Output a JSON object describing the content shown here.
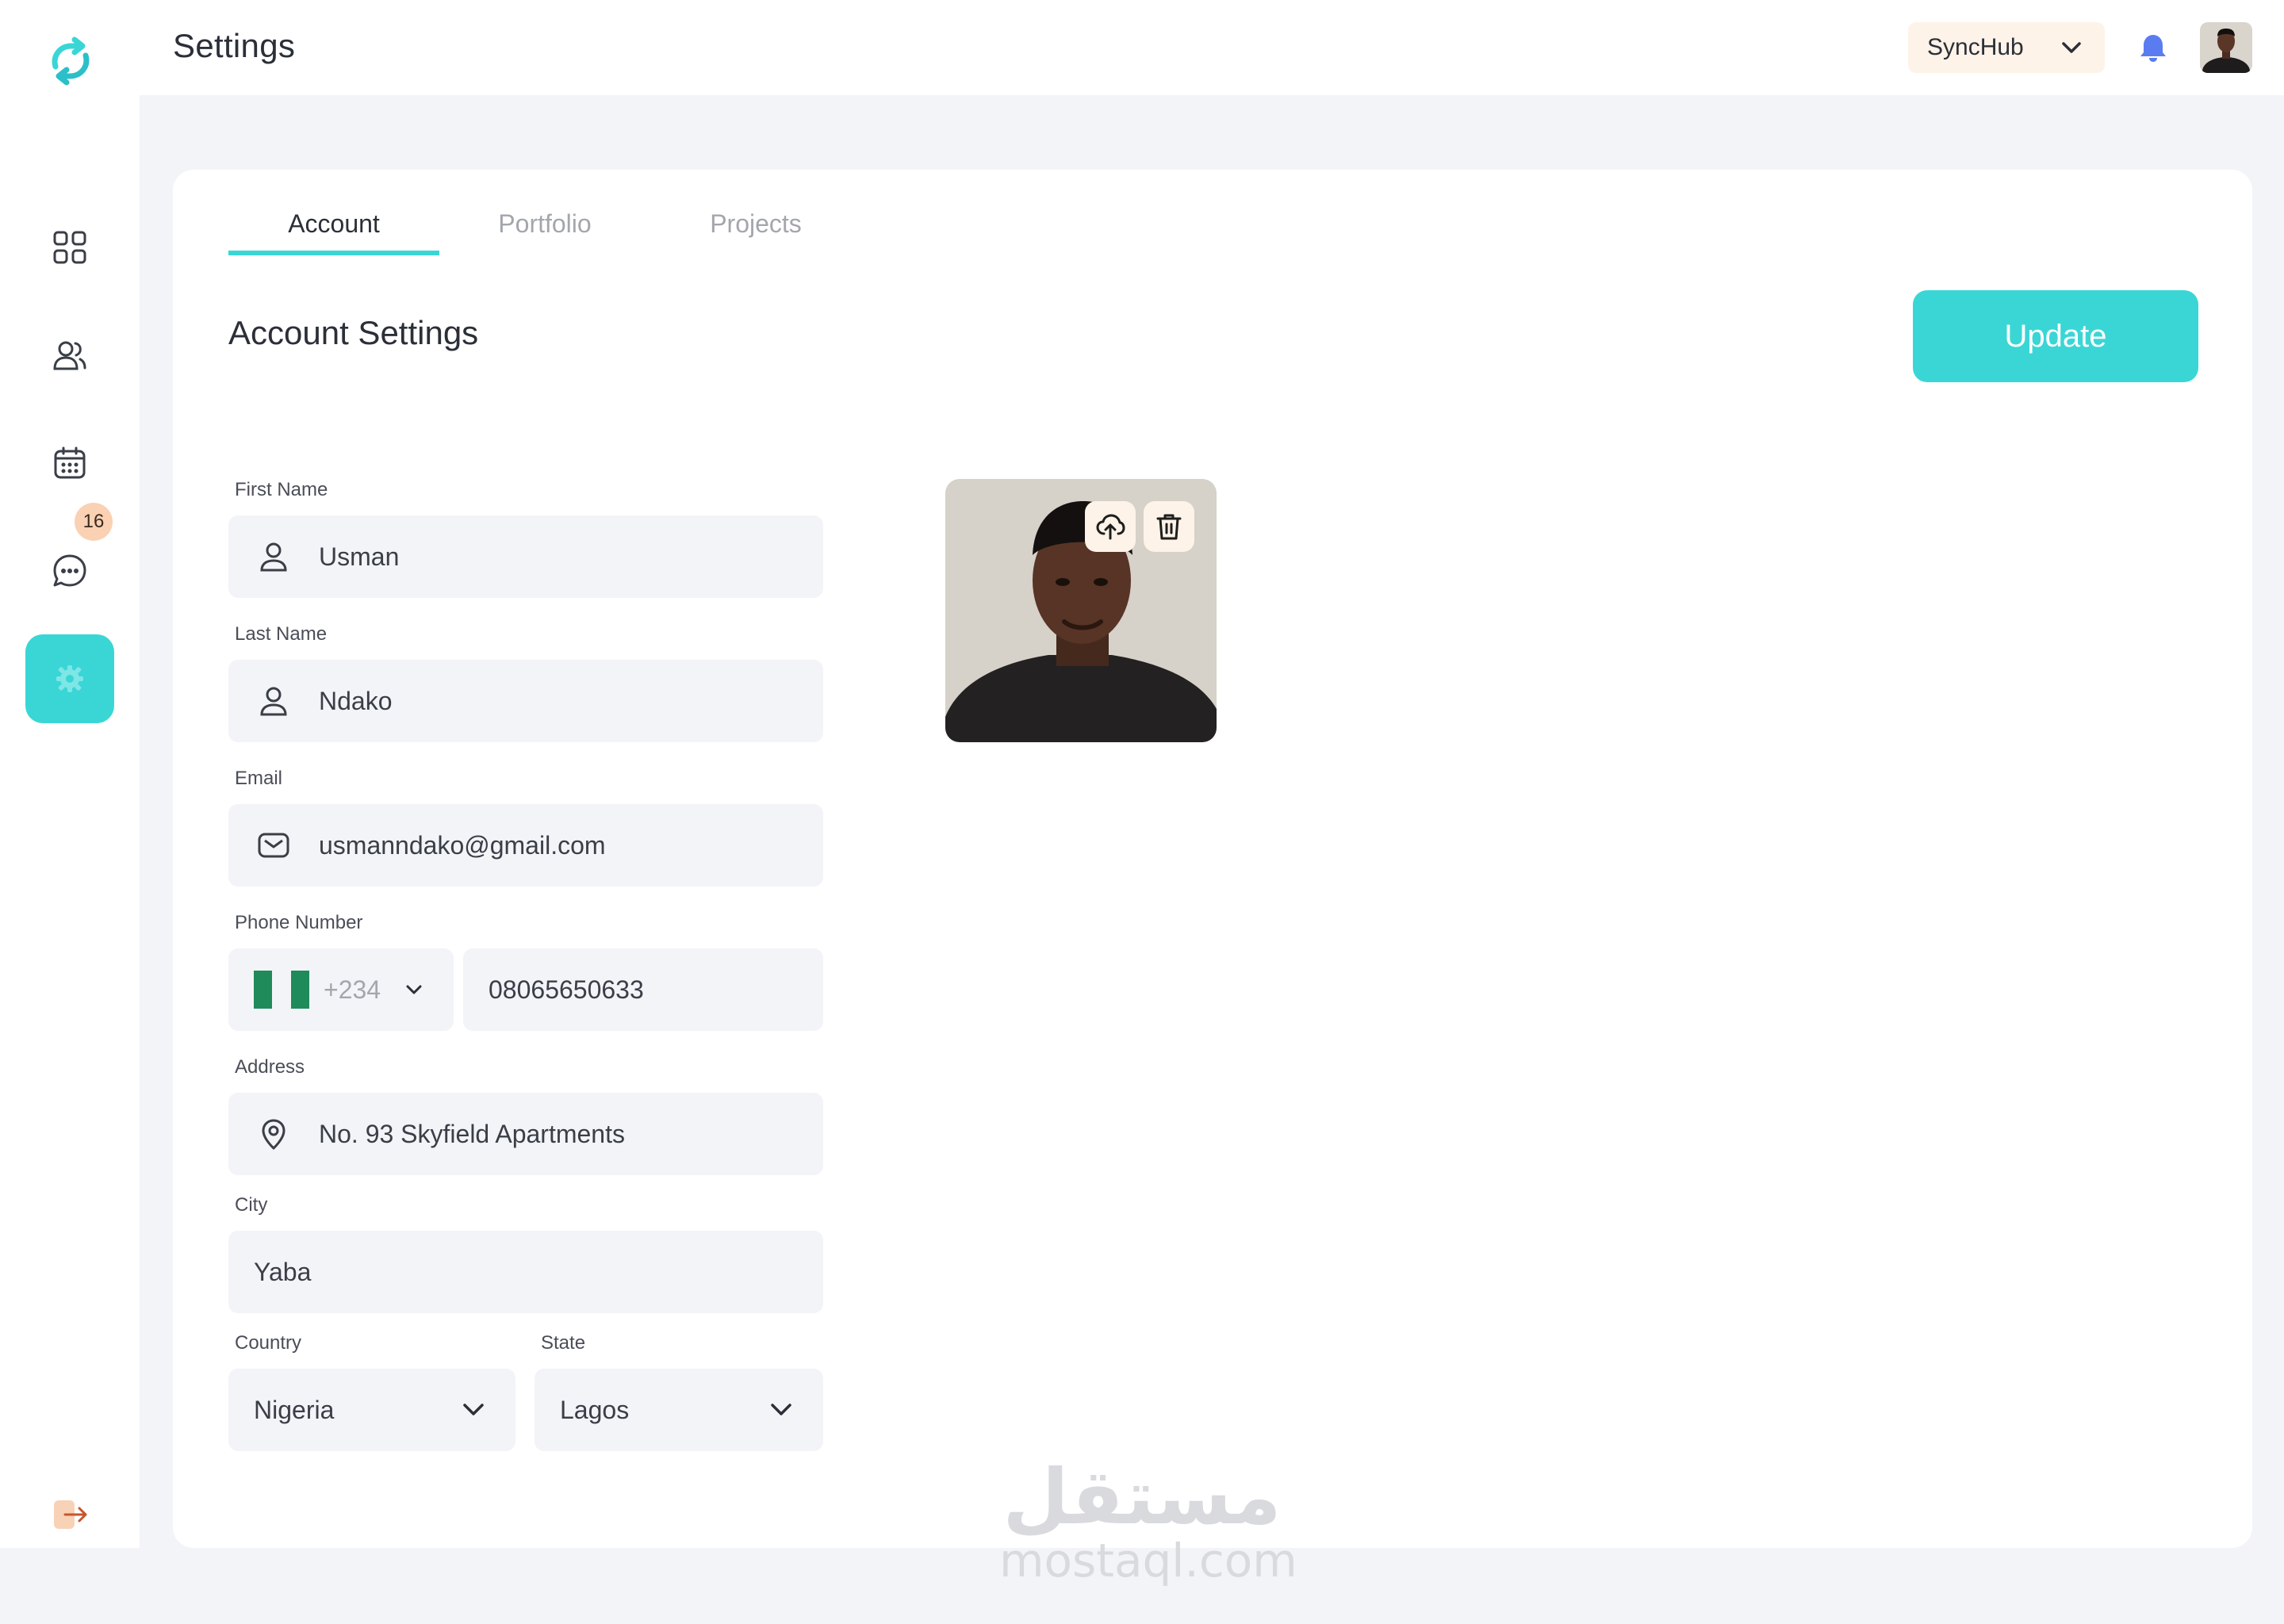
{
  "topbar": {
    "title": "Settings",
    "workspace": "SyncHub"
  },
  "sidebar": {
    "items": [
      {
        "name": "dashboard",
        "icon": "grid-icon"
      },
      {
        "name": "users",
        "icon": "users-icon"
      },
      {
        "name": "calendar",
        "icon": "calendar-icon"
      },
      {
        "name": "messages",
        "icon": "chat-icon",
        "badge": "16"
      },
      {
        "name": "settings",
        "icon": "gear-icon",
        "active": true
      }
    ]
  },
  "tabs": [
    {
      "label": "Account",
      "active": true
    },
    {
      "label": "Portfolio",
      "active": false
    },
    {
      "label": "Projects",
      "active": false
    }
  ],
  "section": {
    "title": "Account Settings",
    "update_label": "Update"
  },
  "form": {
    "first_name": {
      "label": "First Name",
      "value": "Usman"
    },
    "last_name": {
      "label": "Last Name",
      "value": "Ndako"
    },
    "email": {
      "label": "Email",
      "value": "usmanndako@gmail.com"
    },
    "phone": {
      "label": "Phone Number",
      "dial_code": "+234",
      "value": "08065650633"
    },
    "address": {
      "label": "Address",
      "value": "No. 93 Skyfield Apartments"
    },
    "city": {
      "label": "City",
      "value": "Yaba"
    },
    "country": {
      "label": "Country",
      "value": "Nigeria"
    },
    "state": {
      "label": "State",
      "value": "Lagos"
    }
  },
  "watermark": {
    "arabic": "مستقل",
    "latin": "mostaql.com"
  },
  "colors": {
    "accent": "#3ad6d6",
    "badge": "#fad1b3",
    "bell": "#5b7cf0",
    "field_bg": "#f3f4f8",
    "flag_green": "#1f8a5a"
  }
}
